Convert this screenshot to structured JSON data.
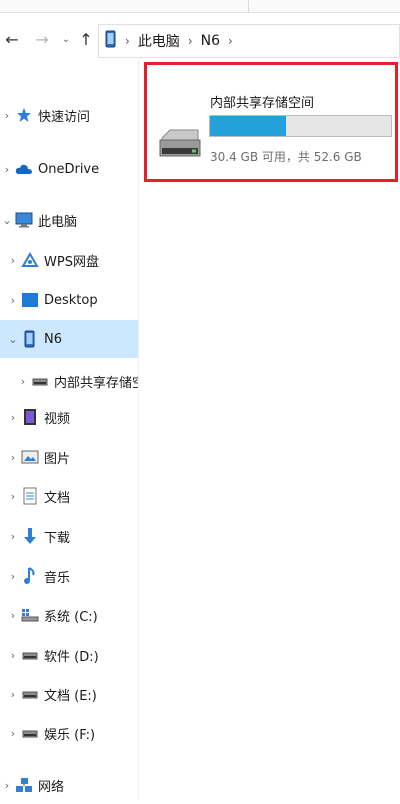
{
  "address": {
    "crumbs": [
      "此电脑",
      "N6"
    ]
  },
  "nav": {
    "items": [
      {
        "label": "快速访问",
        "icon": "quick-access-star-icon",
        "expanded": false,
        "indent": 0
      },
      {
        "label": "OneDrive",
        "icon": "onedrive-cloud-icon",
        "expanded": false,
        "indent": 0
      },
      {
        "label": "此电脑",
        "icon": "this-pc-icon",
        "expanded": true,
        "indent": 0
      },
      {
        "label": "WPS网盘",
        "icon": "wps-cloud-icon",
        "expanded": false,
        "indent": 1
      },
      {
        "label": "Desktop",
        "icon": "desktop-folder-icon",
        "expanded": false,
        "indent": 1
      },
      {
        "label": "N6",
        "icon": "phone-device-icon",
        "expanded": true,
        "indent": 1,
        "selected": true
      },
      {
        "label": "内部共享存储空",
        "icon": "drive-icon",
        "expanded": false,
        "indent": 2
      },
      {
        "label": "视频",
        "icon": "video-folder-icon",
        "expanded": false,
        "indent": 1
      },
      {
        "label": "图片",
        "icon": "pictures-folder-icon",
        "expanded": false,
        "indent": 1
      },
      {
        "label": "文档",
        "icon": "documents-folder-icon",
        "expanded": false,
        "indent": 1
      },
      {
        "label": "下载",
        "icon": "downloads-arrow-icon",
        "expanded": false,
        "indent": 1
      },
      {
        "label": "音乐",
        "icon": "music-note-icon",
        "expanded": false,
        "indent": 1
      },
      {
        "label": "系统 (C:)",
        "icon": "windows-drive-icon",
        "expanded": false,
        "indent": 1
      },
      {
        "label": "软件 (D:)",
        "icon": "drive-icon",
        "expanded": false,
        "indent": 1
      },
      {
        "label": "文档 (E:)",
        "icon": "drive-icon",
        "expanded": false,
        "indent": 1
      },
      {
        "label": "娱乐 (F:)",
        "icon": "drive-icon",
        "expanded": false,
        "indent": 1
      },
      {
        "label": "网络",
        "icon": "network-icon",
        "expanded": false,
        "indent": 0
      }
    ]
  },
  "drive": {
    "name": "内部共享存储空间",
    "space_text": "30.4 GB 可用，共 52.6 GB",
    "used_fraction": 0.42,
    "bar_color": "#26a0da"
  },
  "colors": {
    "selection": "#cce8ff",
    "highlight_border": "#e0222b"
  }
}
